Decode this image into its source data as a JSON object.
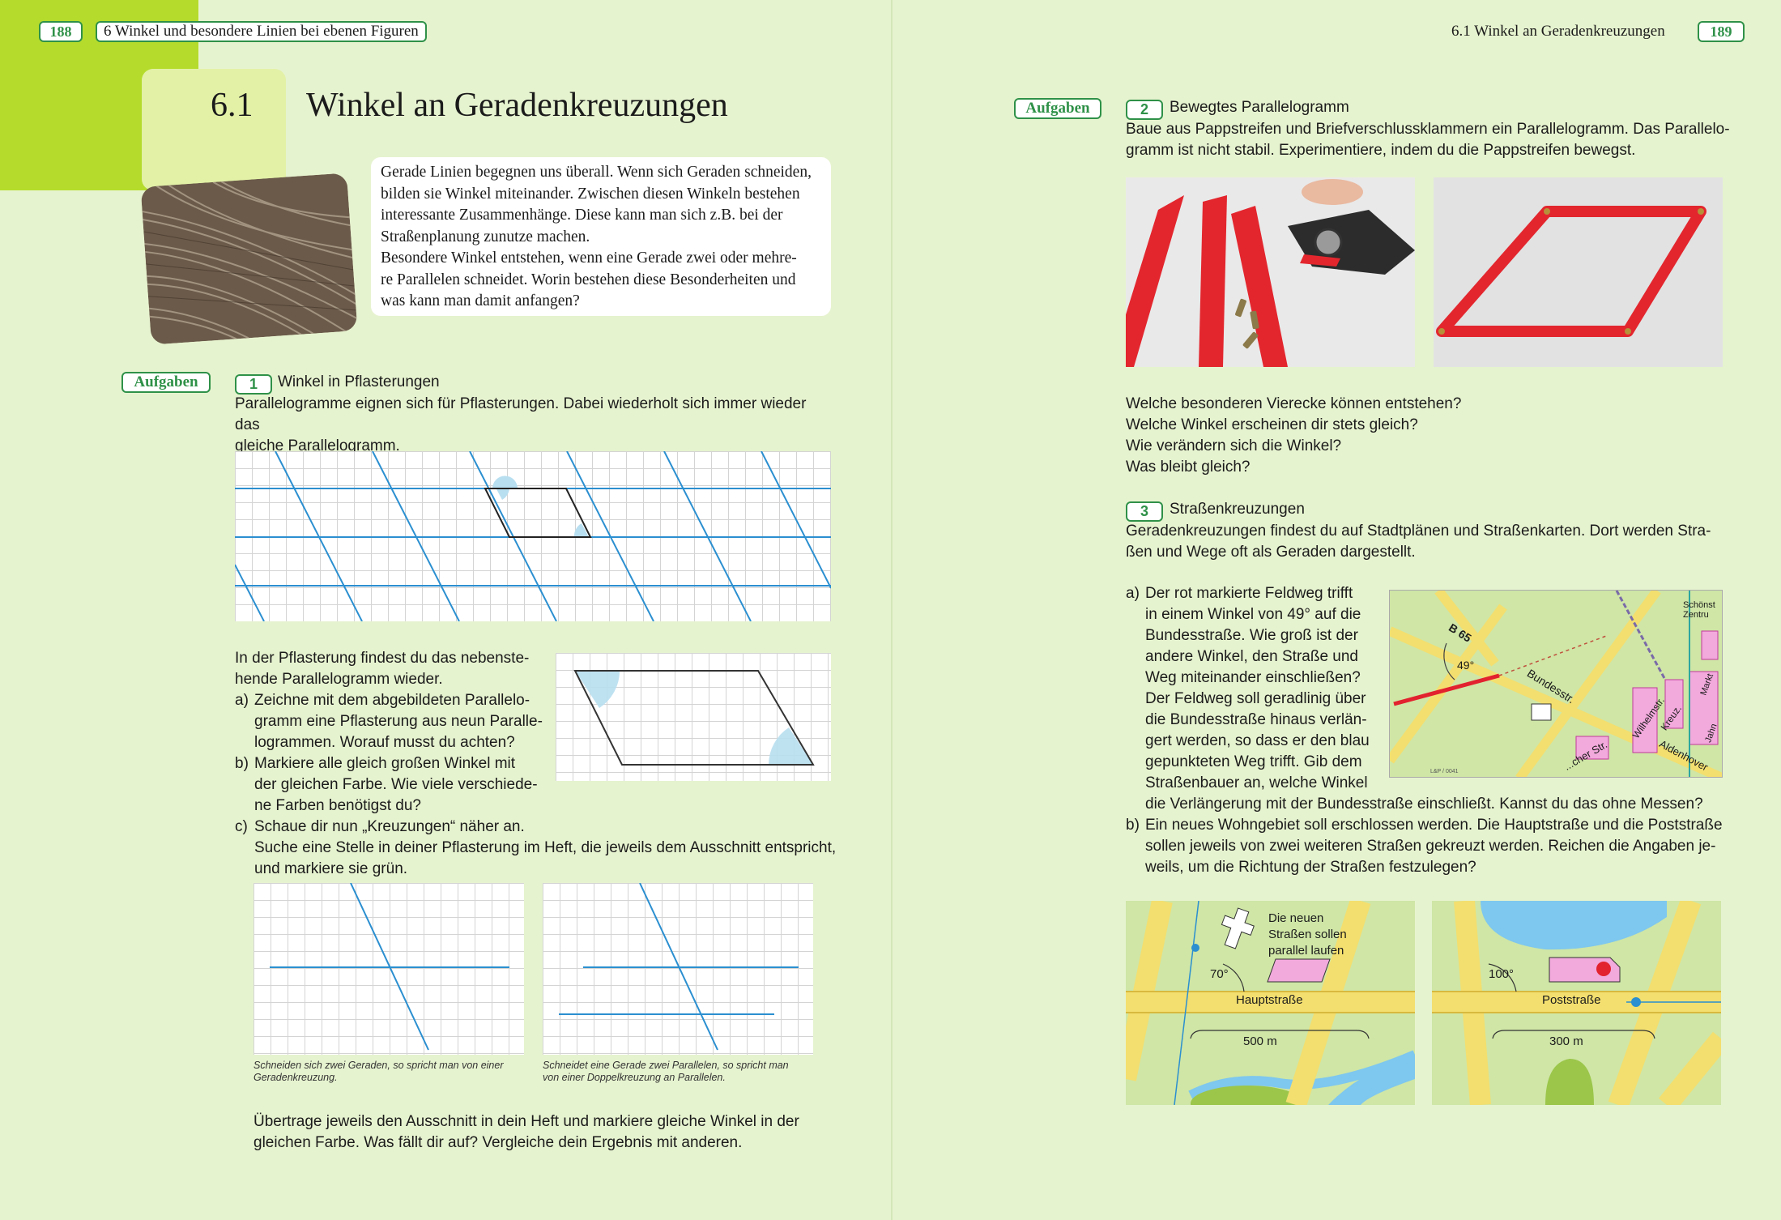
{
  "left_page": {
    "page_number": "188",
    "chapter_header": "6  Winkel und besondere Linien bei ebenen Figuren",
    "section_number": "6.1",
    "section_title": "Winkel an Geradenkreuzungen",
    "intro_lines": [
      "Gerade Linien begegnen uns überall. Wenn sich Geraden schneiden,",
      "bilden sie Winkel miteinander. Zwischen diesen Winkeln bestehen",
      "interessante Zusammenhänge. Diese kann man sich z.B. bei der",
      "Straßenplanung zunutze machen.",
      "Besondere Winkel entstehen, wenn eine Gerade zwei oder mehre-",
      "re Parallelen schneidet. Worin bestehen diese Besonderheiten und",
      "was kann man damit anfangen?"
    ],
    "tasks_label": "Aufgaben",
    "task1": {
      "number": "1",
      "title": "Winkel in Pflasterungen",
      "intro_lines": [
        "Parallelogramme eignen sich für Pflasterungen. Dabei wiederholt sich immer wieder das",
        "gleiche Parallelogramm."
      ],
      "body_lines": [
        "In der Pflasterung findest du das nebenste-",
        "hende Parallelogramm wieder."
      ],
      "part_a": {
        "label": "a)",
        "lines": [
          "Zeichne mit dem abgebildeten Parallelo-",
          "gramm eine Pflasterung aus neun Paralle-",
          "logrammen. Worauf musst du achten?"
        ]
      },
      "part_b": {
        "label": "b)",
        "lines": [
          "Markiere alle gleich großen Winkel mit",
          "der gleichen Farbe. Wie viele verschiede-",
          "ne Farben benötigst du?"
        ]
      },
      "part_c": {
        "label": "c)",
        "lines": [
          "Schaue dir nun „Kreuzungen“ näher an.",
          "Suche eine Stelle in deiner Pflasterung im Heft, die jeweils dem Ausschnitt entspricht,",
          "und markiere sie grün."
        ]
      },
      "caption_left": [
        "Schneiden sich zwei Geraden, so spricht man von einer",
        "Geradenkreuzung."
      ],
      "caption_right": [
        "Schneidet eine Gerade zwei Parallelen, so spricht man",
        "von einer Doppelkreuzung an Parallelen."
      ],
      "closing_lines": [
        "Übertrage jeweils den Ausschnitt in dein Heft und markiere gleiche Winkel in der",
        "gleichen Farbe. Was fällt dir auf? Vergleiche dein Ergebnis mit anderen."
      ]
    }
  },
  "right_page": {
    "page_number": "189",
    "header": "6.1  Winkel an Geradenkreuzungen",
    "tasks_label": "Aufgaben",
    "task2": {
      "number": "2",
      "title": "Bewegtes Parallelogramm",
      "intro_lines": [
        "Baue aus Pappstreifen und Briefverschlussklammern ein Parallelogramm. Das Parallelo-",
        "gramm ist nicht stabil. Experimentiere, indem du die Pappstreifen bewegst."
      ],
      "questions": [
        "Welche besonderen Vierecke können entstehen?",
        "Welche Winkel erscheinen dir stets gleich?",
        "Wie verändern sich die Winkel?",
        "Was bleibt gleich?"
      ]
    },
    "task3": {
      "number": "3",
      "title": "Straßenkreuzungen",
      "intro_lines": [
        "Geradenkreuzungen findest du auf Stadtplänen und Straßenkarten. Dort werden Stra-",
        "ßen und Wege oft als Geraden dargestellt."
      ],
      "part_a": {
        "label": "a)",
        "lines": [
          "Der rot markierte Feldweg trifft",
          "in einem Winkel von 49° auf die",
          "Bundesstraße. Wie groß ist der",
          "andere Winkel, den Straße und",
          "Weg miteinander einschließen?",
          "Der Feldweg soll geradlinig über",
          "die Bundesstraße hinaus verlän-",
          "gert werden, so dass er den blau",
          "gepunkteten Weg trifft. Gib dem",
          "Straßenbauer an, welche Winkel",
          "die Verlängerung mit der Bundesstraße einschließt. Kannst du das ohne Messen?"
        ]
      },
      "part_b": {
        "label": "b)",
        "lines": [
          "Ein neues Wohngebiet soll erschlossen werden. Die Hauptstraße und die Poststraße",
          "sollen jeweils von zwei weiteren Straßen gekreuzt werden. Reichen die Angaben je-",
          "weils, um die Richtung der Straßen festzulegen?"
        ]
      },
      "map": {
        "road_label": "B 65",
        "angle": "49°",
        "street1": "Bundesstr.",
        "street2": "Wilhelmstr.",
        "street3": "Kreuz.",
        "street4": "Aldenhover",
        "street5": "...cher Str.",
        "street6": "Markt",
        "street7": "Jahn",
        "corner_label1": "Schönst",
        "corner_label2": "Zentru",
        "credit": "L&P / 0041"
      },
      "diagram_left": {
        "note_lines": [
          "Die neuen",
          "Straßen sollen",
          "parallel laufen"
        ],
        "angle": "70°",
        "street": "Hauptstraße",
        "distance": "500 m"
      },
      "diagram_right": {
        "angle": "100°",
        "street": "Poststraße",
        "distance": "300 m"
      }
    }
  },
  "colors": {
    "background": "#e6f3cf",
    "accent_green": "#2f9148",
    "corner_lime": "#b5dc2c",
    "grid_blue": "#2b8fd0",
    "angle_fill": "#b8dff0",
    "road_yellow": "#f7e27a",
    "map_red": "#e2222e"
  }
}
